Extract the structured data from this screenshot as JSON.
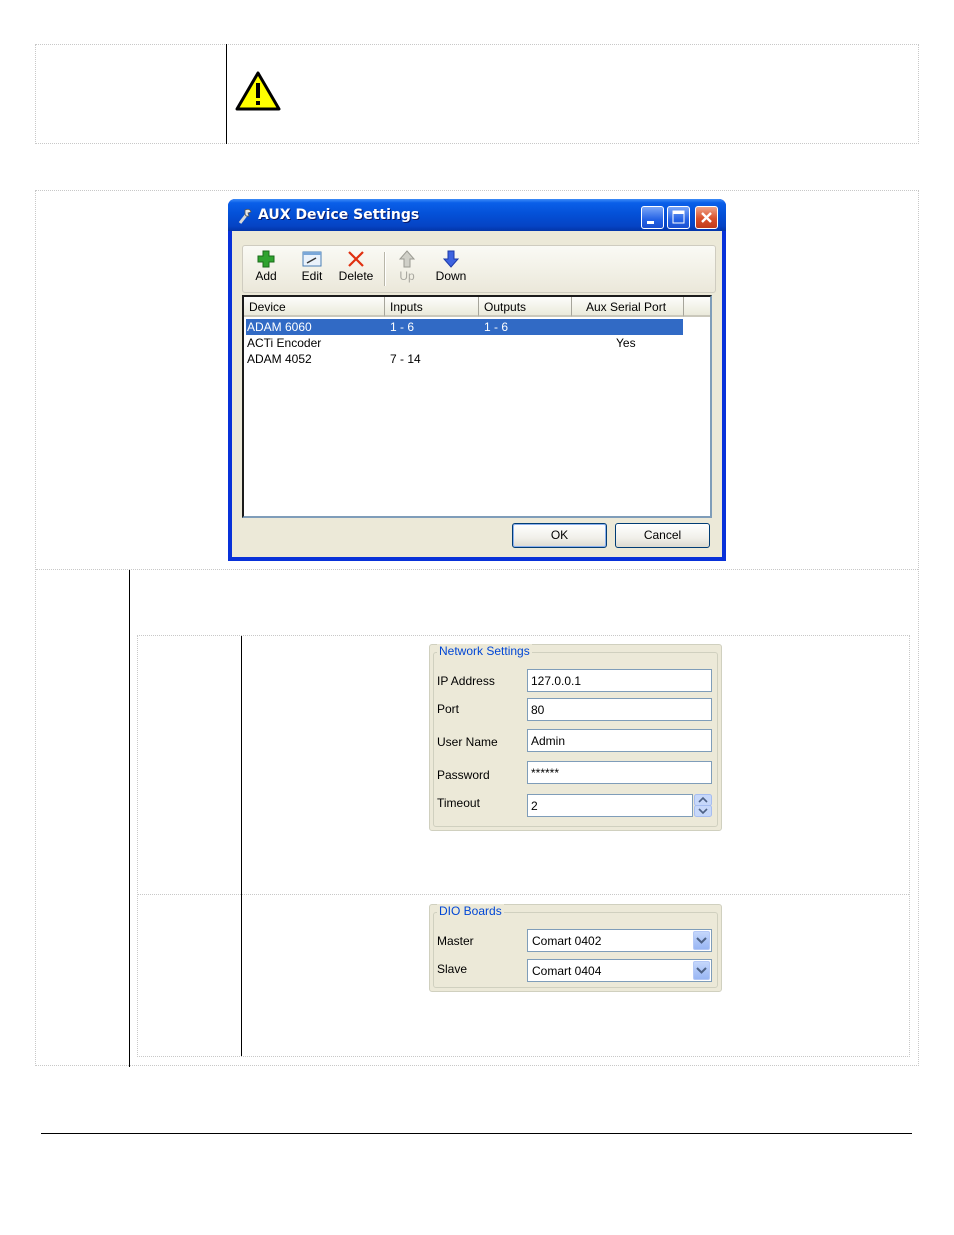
{
  "window": {
    "title": "AUX Device Settings",
    "toolbar": {
      "add": "Add",
      "edit": "Edit",
      "delete": "Delete",
      "up": "Up",
      "down": "Down"
    },
    "columns": [
      "Device",
      "Inputs",
      "Outputs",
      "Aux Serial Port"
    ],
    "rows": [
      {
        "device": "ADAM 6060",
        "inputs": "1 - 6",
        "outputs": "1 - 6",
        "aux": "",
        "selected": true
      },
      {
        "device": "ACTi Encoder",
        "inputs": "",
        "outputs": "",
        "aux": "Yes",
        "selected": false
      },
      {
        "device": "ADAM 4052",
        "inputs": "7 - 14",
        "outputs": "",
        "aux": "",
        "selected": false
      }
    ],
    "ok_label": "OK",
    "cancel_label": "Cancel"
  },
  "network": {
    "title": "Network Settings",
    "ip_label": "IP Address",
    "ip_value": "127.0.0.1",
    "port_label": "Port",
    "port_value": "80",
    "user_label": "User Name",
    "user_value": "Admin",
    "password_label": "Password",
    "password_value": "******",
    "timeout_label": "Timeout",
    "timeout_value": "2"
  },
  "dio": {
    "title": "DIO Boards",
    "master_label": "Master",
    "master_value": "Comart 0402",
    "slave_label": "Slave",
    "slave_value": "Comart 0404"
  },
  "icons": {
    "warning": "warning-triangle-icon",
    "add": "plus-icon",
    "edit": "edit-icon",
    "delete": "x-icon",
    "up": "arrow-up-icon",
    "down": "arrow-down-icon"
  },
  "colors": {
    "titlebar": "#0451d8",
    "selection": "#316ac5",
    "group_title": "#0046d5",
    "warning_fill": "#ffff00"
  }
}
